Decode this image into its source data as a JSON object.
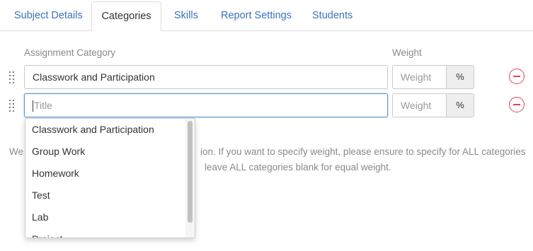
{
  "tabs": [
    {
      "label": "Subject Details",
      "active": false
    },
    {
      "label": "Categories",
      "active": true
    },
    {
      "label": "Skills",
      "active": false
    },
    {
      "label": "Report Settings",
      "active": false
    },
    {
      "label": "Students",
      "active": false
    }
  ],
  "columns": {
    "category": "Assignment Category",
    "weight": "Weight"
  },
  "rows": [
    {
      "title": "Classwork and Participation",
      "title_placeholder": "Title",
      "weight_placeholder": "Weight",
      "unit": "%"
    },
    {
      "title": "",
      "title_placeholder": "Title",
      "weight_placeholder": "Weight",
      "unit": "%"
    }
  ],
  "note": {
    "line1_left": "We",
    "line1_right": "ion. If you want to specify weight, please ensure to specify for ALL categories",
    "line2_right": "leave ALL categories blank for equal weight."
  },
  "dropdown": {
    "options": [
      "Classwork and Participation",
      "Group Work",
      "Homework",
      "Test",
      "Lab",
      "Project"
    ]
  },
  "colors": {
    "link": "#3b73b9",
    "remove": "#d6485a",
    "focus_border": "#5b9bd5"
  }
}
